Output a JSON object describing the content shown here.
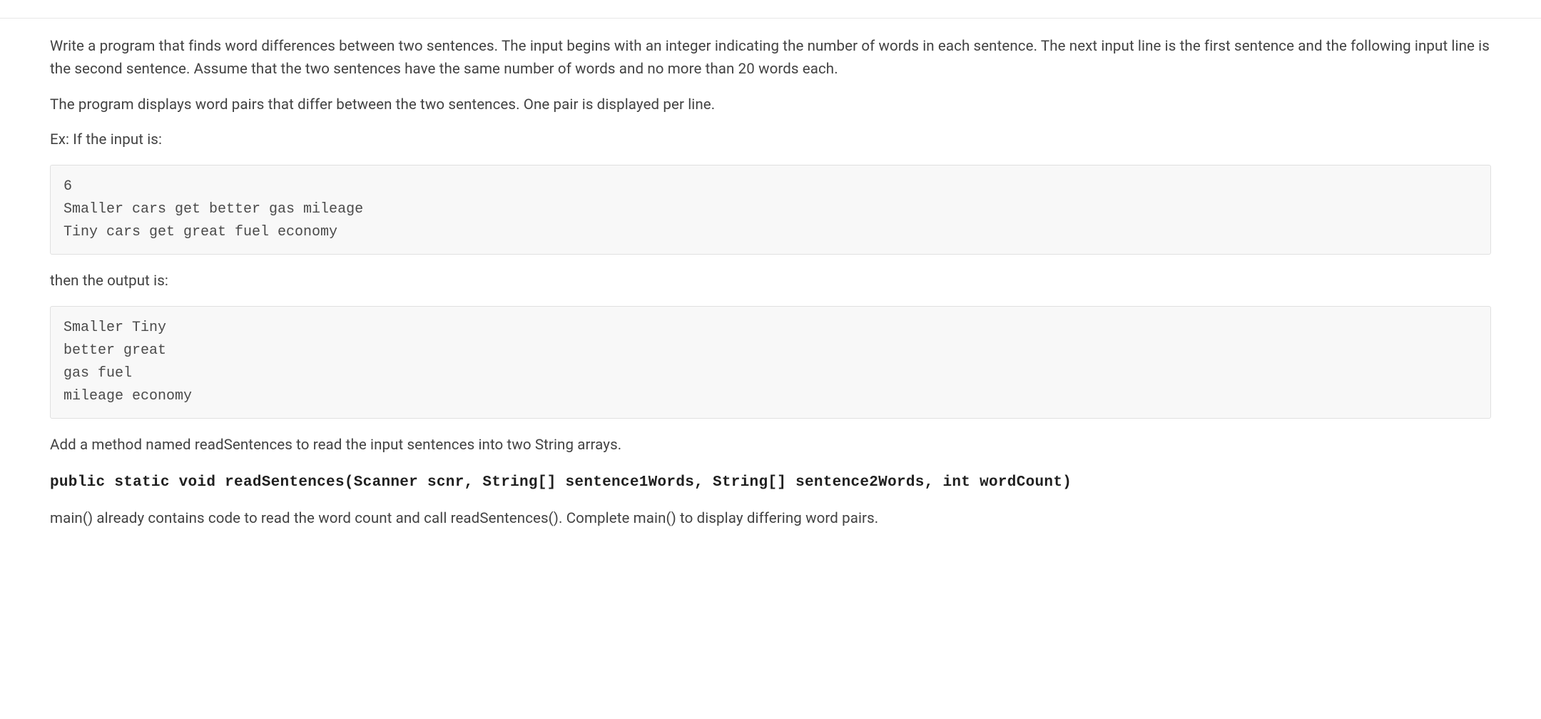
{
  "content": {
    "top_divider": true,
    "para1": "Write a program that finds word differences between two sentences. The input begins with an integer indicating the number of words in each sentence. The next input line is the first sentence and the following input line is the second sentence. Assume that the two sentences have the same number of words and no more than 20 words each.",
    "para2": "The program displays word pairs that differ between the two sentences. One pair is displayed per line.",
    "para3": "Ex: If the input is:",
    "code1": "6\nSmaller cars get better gas mileage\nTiny cars get great fuel economy",
    "para4": "then the output is:",
    "code2": "Smaller Tiny\nbetter great\ngas fuel\nmileage economy",
    "para5": "Add a method named readSentences to read the input sentences into two String arrays.",
    "signature": "public static void readSentences(Scanner scnr, String[] sentence1Words, String[] sentence2Words, int wordCount)",
    "para6": "main() already contains code to read the word count and call readSentences(). Complete main() to display differing word pairs."
  }
}
